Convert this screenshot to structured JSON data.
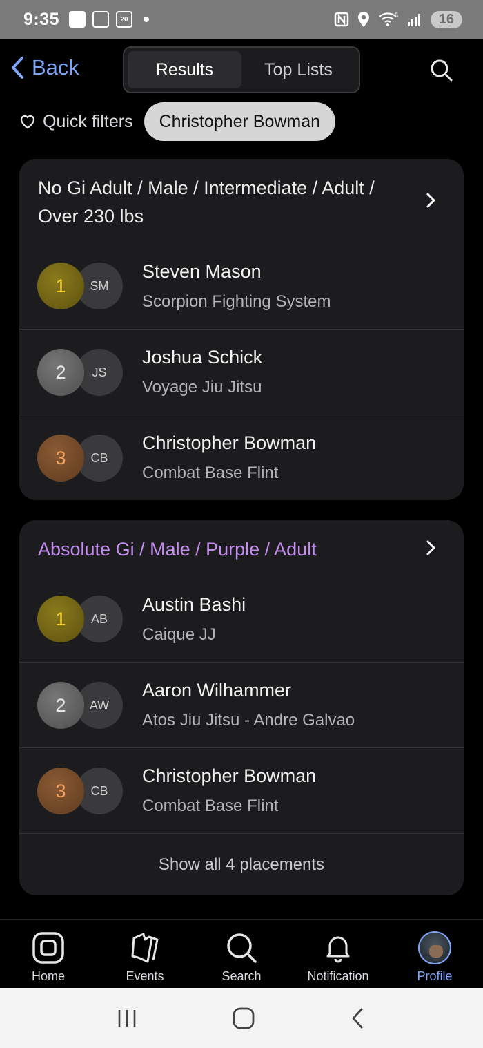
{
  "status_bar": {
    "time": "9:35",
    "calendar_day": "20",
    "network": "5",
    "battery": "16"
  },
  "header": {
    "back_label": "Back",
    "tabs": [
      {
        "label": "Results",
        "active": true
      },
      {
        "label": "Top Lists",
        "active": false
      }
    ]
  },
  "filters": {
    "quick_filters_label": "Quick filters",
    "active_chip": "Christopher Bowman"
  },
  "divisions": [
    {
      "title": "No Gi Adult / Male / Intermediate / Adult / Over 230 lbs",
      "highlighted": false,
      "placements": [
        {
          "rank": "1",
          "initials": "SM",
          "name": "Steven Mason",
          "team": "Scorpion Fighting System"
        },
        {
          "rank": "2",
          "initials": "JS",
          "name": "Joshua Schick",
          "team": "Voyage Jiu Jitsu"
        },
        {
          "rank": "3",
          "initials": "CB",
          "name": "Christopher Bowman",
          "team": "Combat Base Flint"
        }
      ]
    },
    {
      "title": "Absolute Gi / Male / Purple / Adult",
      "highlighted": true,
      "placements": [
        {
          "rank": "1",
          "initials": "AB",
          "name": "Austin Bashi",
          "team": "Caique JJ"
        },
        {
          "rank": "2",
          "initials": "AW",
          "name": "Aaron Wilhammer",
          "team": "Atos Jiu Jitsu - Andre Galvao"
        },
        {
          "rank": "3",
          "initials": "CB",
          "name": "Christopher Bowman",
          "team": "Combat Base Flint"
        }
      ],
      "show_all_label": "Show all 4 placements"
    }
  ],
  "bottom_nav": [
    {
      "label": "Home",
      "icon": "home-icon"
    },
    {
      "label": "Events",
      "icon": "events-icon"
    },
    {
      "label": "Search",
      "icon": "search-icon"
    },
    {
      "label": "Notification",
      "icon": "bell-icon"
    },
    {
      "label": "Profile",
      "icon": "profile-avatar",
      "active": true
    }
  ],
  "colors": {
    "accent": "#7da4f5",
    "highlight_division": "#c48df0",
    "gold": "#f2d22e",
    "silver": "#e8e8e8",
    "bronze": "#f3a15c",
    "card_bg": "#1c1c1e"
  }
}
